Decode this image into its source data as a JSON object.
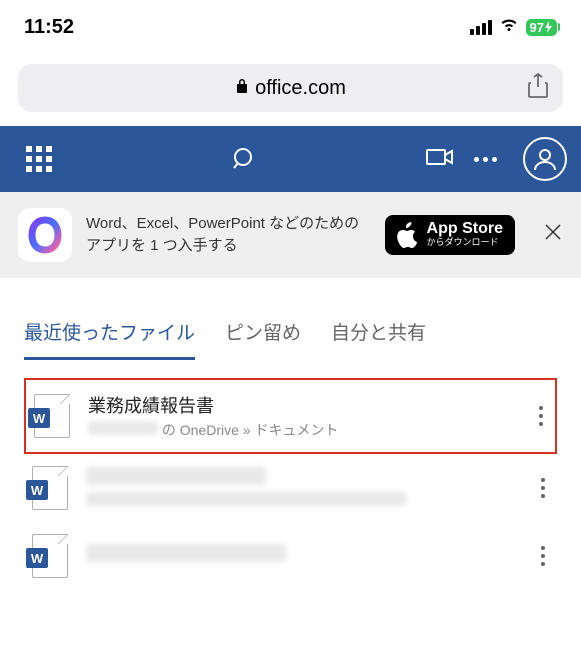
{
  "status": {
    "time": "11:52",
    "battery": "97"
  },
  "browser": {
    "url": "office.com"
  },
  "promo": {
    "text": "Word、Excel、PowerPoint などのためのアプリを 1 つ入手する",
    "store_top": "App Store",
    "store_bottom": "からダウンロード"
  },
  "tabs": [
    {
      "label": "最近使ったファイル",
      "active": true
    },
    {
      "label": "ピン留め",
      "active": false
    },
    {
      "label": "自分と共有",
      "active": false
    }
  ],
  "files": [
    {
      "name": "業務成績報告書",
      "meta_suffix": " の OneDrive » ドキュメント",
      "redacted_owner": true,
      "highlighted": true
    },
    {
      "name": "",
      "meta_suffix": "",
      "redacted_owner": false,
      "highlighted": false,
      "blurred": true
    },
    {
      "name": "",
      "meta_suffix": "",
      "redacted_owner": false,
      "highlighted": false,
      "blurred": true
    }
  ]
}
